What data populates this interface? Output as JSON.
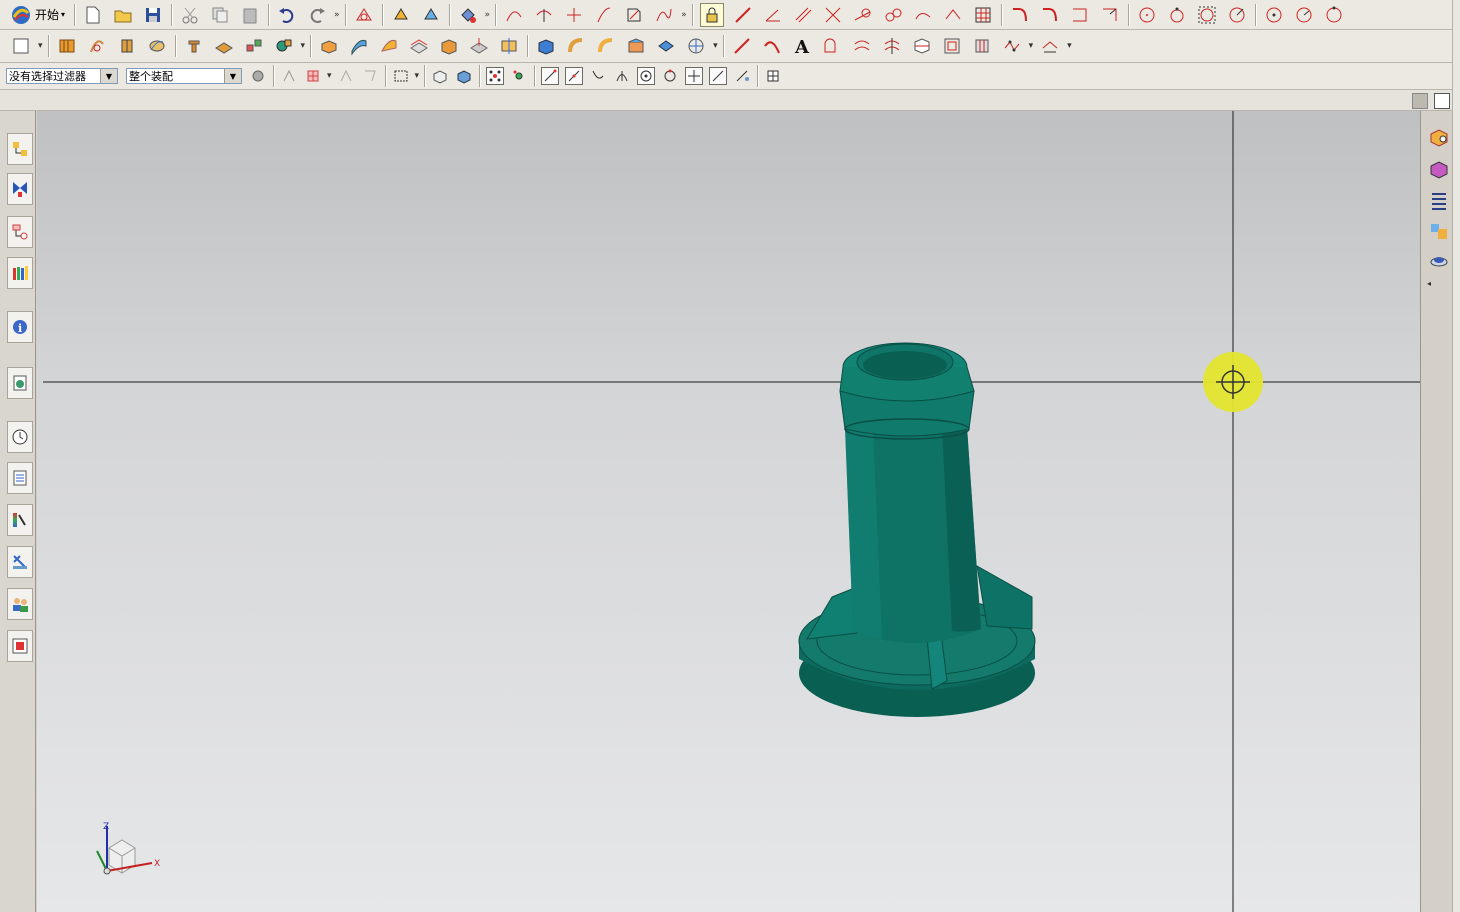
{
  "app": {
    "start_label": "开始",
    "start_icon": "nx-logo-icon"
  },
  "filter_bar": {
    "selection_filter": "没有选择过滤器",
    "scope": "整个装配"
  },
  "viewport": {
    "background_top": "#bfc0c2",
    "background_bottom": "#e6e7e8",
    "part_color": "#0d6b5e",
    "cursor_color": "#e4e63a",
    "triad_labels": {
      "x": "X",
      "z": "Z"
    }
  },
  "toolbar_overflow_glyph": "»",
  "left_panel": {
    "items": [
      "assembly-navigator-icon",
      "constraint-navigator-icon",
      "part-navigator-icon",
      "reuse-library-icon",
      "info-icon",
      "web-browser-icon",
      "history-icon",
      "process-studio-icon",
      "visualization-icon",
      "system-materials-icon",
      "roles-icon",
      "hd3d-icon"
    ]
  }
}
